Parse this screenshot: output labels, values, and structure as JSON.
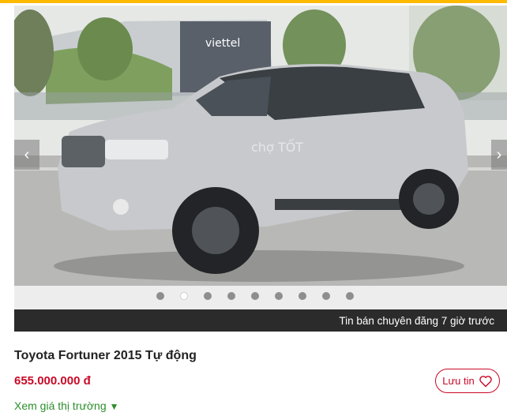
{
  "gallery": {
    "photo_alt": "Toyota Fortuner silver",
    "building_sign": "viettel",
    "watermark": "chợ TỐT",
    "prev_icon": "chevron-left-icon",
    "next_icon": "chevron-right-icon",
    "arrow_left_glyph": "‹",
    "arrow_right_glyph": "›",
    "image_count": 9,
    "active_index": 1
  },
  "caption": {
    "text": "Tin bán chuyên đăng 7 giờ trước"
  },
  "listing": {
    "title": "Toyota Fortuner 2015 Tự động",
    "price": "655.000.000 đ",
    "save_label": "Lưu tin",
    "save_icon": "heart-outline-icon",
    "market_link": "Xem giá thị trường",
    "market_icon": "triangle-down-icon",
    "market_glyph": "▼"
  },
  "colors": {
    "accent": "#ffba00",
    "price": "#c90927",
    "market_link": "#2c8e2c",
    "caption_bg": "#2b2b2b"
  }
}
